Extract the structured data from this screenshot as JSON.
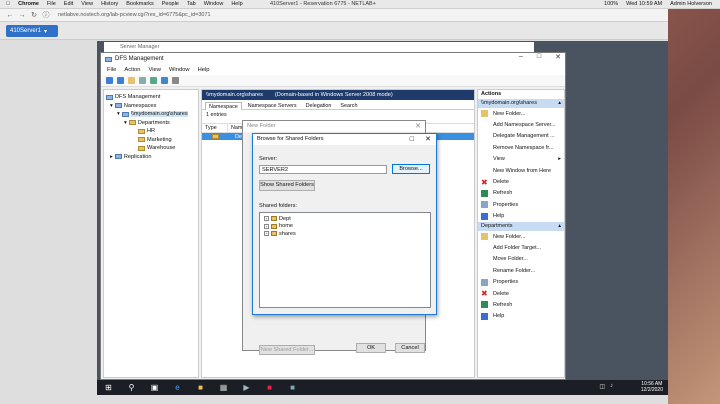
{
  "mac_menubar": {
    "apple": "",
    "app": "Chrome",
    "items": [
      "File",
      "Edit",
      "View",
      "History",
      "Bookmarks",
      "People",
      "Tab",
      "Window",
      "Help"
    ],
    "center_title": "410Server1 - Reservation 6775 - NETLAB+",
    "battery": "100%",
    "clock": "Wed 10:59 AM",
    "user": "Admin Holverson"
  },
  "browser": {
    "url": "netlabve.nostech.org/lab-pcview.cgi?res_id=6775&pc_id=3071",
    "server_tab_label": "410Server1"
  },
  "server_manager": {
    "title": "Server Manager"
  },
  "dfs": {
    "title": "DFS Management",
    "menu": [
      "File",
      "Action",
      "View",
      "Window",
      "Help"
    ],
    "tree": [
      {
        "label": "DFS Management",
        "indent": 0
      },
      {
        "label": "Namespaces",
        "indent": 1
      },
      {
        "label": "\\\\mydomain.org\\shares",
        "indent": 2,
        "selected": true
      },
      {
        "label": "Departments",
        "indent": 3
      },
      {
        "label": "HR",
        "indent": 4
      },
      {
        "label": "Marketing",
        "indent": 4
      },
      {
        "label": "Warehouse",
        "indent": 4
      },
      {
        "label": "Replication",
        "indent": 1
      }
    ],
    "center": {
      "header_path": "\\\\mydomain.org\\shares",
      "header_mode": "(Domain-based in Windows Server 2008 mode)",
      "tabs": [
        "Namespace",
        "Namespace Servers",
        "Delegation",
        "Search"
      ],
      "entries": "1 entries",
      "columns": [
        "Type",
        "Name"
      ],
      "row_name": "Depa"
    },
    "actions": {
      "header": "Actions",
      "section1": "\\\\mydomain.org\\shares",
      "items1": [
        "New Folder...",
        "Add Namespace Server...",
        "Delegate Management ...",
        "Remove Namespace fr...",
        "View",
        "New Window from Here",
        "Delete",
        "Refresh",
        "Properties",
        "Help"
      ],
      "section2": "Departments",
      "items2": [
        "New Folder...",
        "Add Folder Target...",
        "Move Folder...",
        "Rename Folder...",
        "Properties",
        "Delete",
        "Refresh",
        "Help"
      ]
    }
  },
  "new_folder_dialog": {
    "title": "New Folder"
  },
  "browse_dialog": {
    "title": "Browse for Shared Folders",
    "server_label": "Server:",
    "server_value": "SERVER2",
    "browse_button": "Browse...",
    "show_button": "Show Shared Folders",
    "shared_label": "Shared folders:",
    "folders": [
      "Dept",
      "home",
      "shares"
    ],
    "new_shared_button": "New Shared Folder...",
    "ok": "OK",
    "cancel": "Cancel"
  },
  "taskbar": {
    "time": "10:56 AM",
    "date": "12/2/2020"
  }
}
